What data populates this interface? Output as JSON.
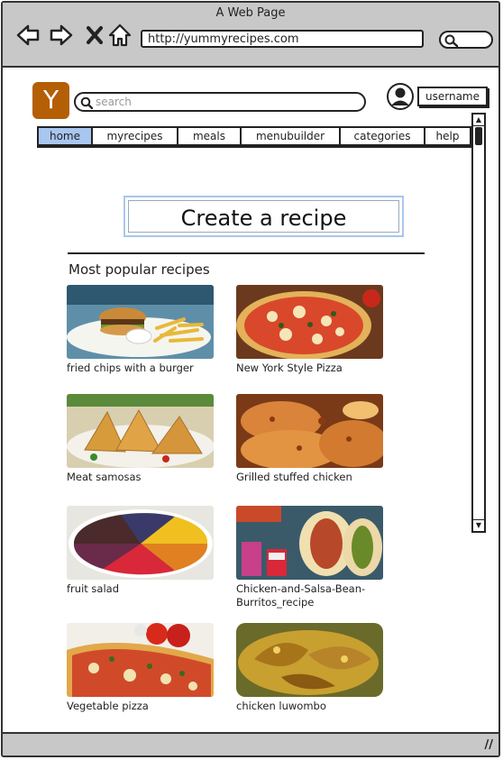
{
  "window": {
    "title": "A Web Page"
  },
  "browser": {
    "url": "http://yummyrecipes.com"
  },
  "site": {
    "logo_letter": "Y",
    "search_placeholder": "search",
    "username": "username"
  },
  "nav": {
    "tabs": [
      {
        "label": "home",
        "active": true
      },
      {
        "label": "myrecipes"
      },
      {
        "label": "meals"
      },
      {
        "label": "menubuilder"
      },
      {
        "label": "categories"
      },
      {
        "label": "help"
      }
    ]
  },
  "main": {
    "create_button_label": "Create a recipe",
    "section_title": "Most popular recipes",
    "recipes": [
      {
        "caption": "fried chips with a burger"
      },
      {
        "caption": "New York Style Pizza"
      },
      {
        "caption": "Meat samosas"
      },
      {
        "caption": "Grilled stuffed chicken"
      },
      {
        "caption": "fruit salad"
      },
      {
        "caption": "Chicken-and-Salsa-Bean-Burritos_recipe"
      },
      {
        "caption": "Vegetable pizza"
      },
      {
        "caption": "chicken luwombo"
      }
    ]
  },
  "colors": {
    "active_tab": "#a8c6ef",
    "logo": "#b45f06",
    "chrome": "#c8c8c8"
  }
}
